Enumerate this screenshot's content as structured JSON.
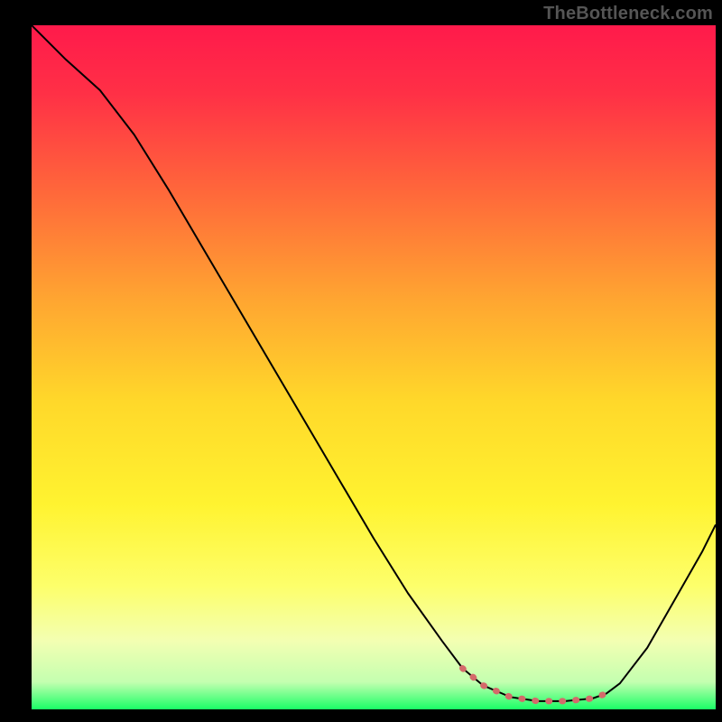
{
  "watermark": "TheBottleneck.com",
  "chart_data": {
    "type": "line",
    "title": "",
    "xlabel": "",
    "ylabel": "",
    "xlim": [
      0,
      100
    ],
    "ylim": [
      0,
      100
    ],
    "grid": false,
    "background": {
      "type": "vertical-gradient",
      "stops": [
        {
          "offset": 0.0,
          "color": "#ff1a4b"
        },
        {
          "offset": 0.1,
          "color": "#ff3046"
        },
        {
          "offset": 0.25,
          "color": "#ff6a3a"
        },
        {
          "offset": 0.4,
          "color": "#ffa531"
        },
        {
          "offset": 0.55,
          "color": "#ffd82a"
        },
        {
          "offset": 0.7,
          "color": "#fff330"
        },
        {
          "offset": 0.82,
          "color": "#fdff6b"
        },
        {
          "offset": 0.9,
          "color": "#f3ffb2"
        },
        {
          "offset": 0.96,
          "color": "#c4ffb0"
        },
        {
          "offset": 1.0,
          "color": "#1aff66"
        }
      ]
    },
    "series": [
      {
        "name": "curve",
        "color": "#000000",
        "stroke_width": 2,
        "x": [
          0,
          5,
          10,
          15,
          20,
          25,
          30,
          35,
          40,
          45,
          50,
          55,
          60,
          63,
          66,
          70,
          74,
          78,
          82,
          84,
          86,
          90,
          94,
          98,
          100
        ],
        "y": [
          100,
          95,
          90.5,
          84,
          76,
          67.5,
          59,
          50.5,
          42,
          33.5,
          25,
          17,
          10,
          6,
          3.5,
          1.8,
          1.2,
          1.2,
          1.6,
          2.3,
          3.8,
          9,
          16,
          23,
          27
        ]
      },
      {
        "name": "optimal-band",
        "color": "#d46a6a",
        "stroke_width": 7,
        "dash": "1 14",
        "linecap": "round",
        "x": [
          63,
          66,
          70,
          74,
          78,
          82,
          84
        ],
        "y": [
          6,
          3.5,
          1.8,
          1.2,
          1.2,
          1.6,
          2.3
        ]
      }
    ]
  }
}
